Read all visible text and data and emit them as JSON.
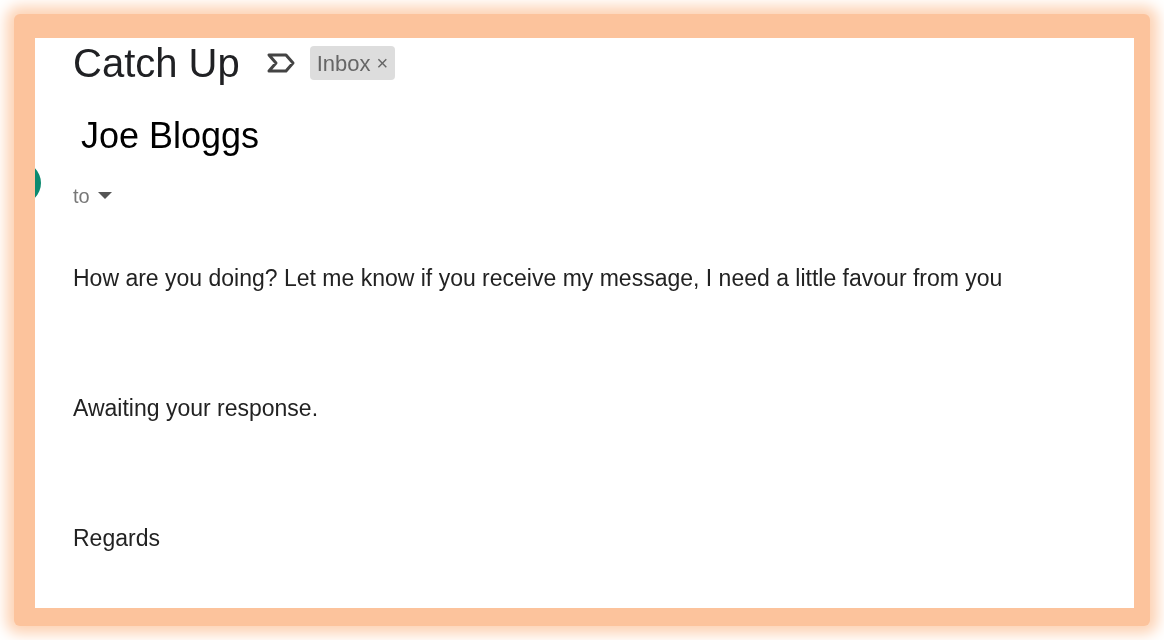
{
  "email": {
    "subject": "Catch Up",
    "label": {
      "text": "Inbox",
      "remove": "×"
    },
    "sender": "Joe Bloggs",
    "recipient_label": "to",
    "body": [
      "How are you doing? Let me know if you receive my message, I need a little favour from you",
      "Awaiting your response.",
      "Regards"
    ]
  }
}
